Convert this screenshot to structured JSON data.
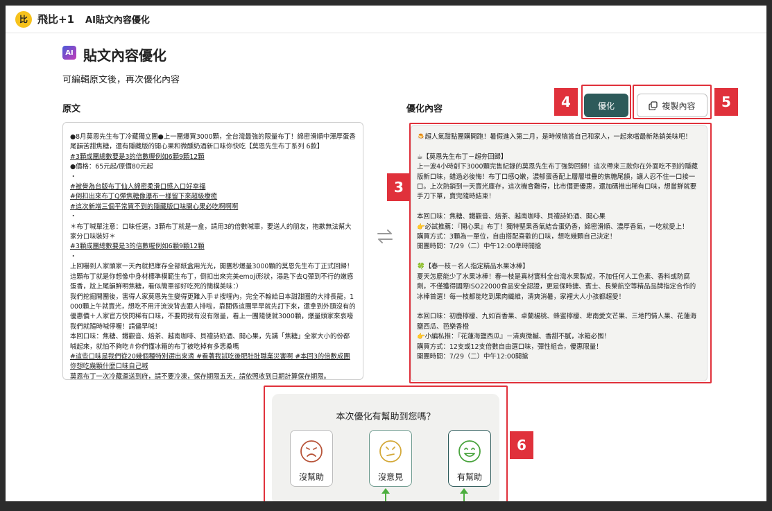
{
  "header": {
    "logo_text": "比",
    "brand": "飛比+1",
    "app_title": "AI貼文內容優化"
  },
  "page": {
    "ai_badge": "AI",
    "title": "貼文內容優化",
    "subtitle": "可編輯原文後，再次優化內容"
  },
  "labels": {
    "original": "原文",
    "optimized": "優化內容"
  },
  "original_lines": [
    {
      "t": "●8月莫恩先生布丁冷藏獨立團●上一團爆買3000顆，全台灣最強的限量布丁！綿密滑順中渾厚蛋香尾韻苦甜焦糖，還有隱藏版的開心果和微醺奶酒新口味你快吃【莫恩先生布丁系列 6款】",
      "u": false
    },
    {
      "t": "#3顆成團總數要是3的倍數喔例如6顆9顆12顆",
      "u": true
    },
    {
      "t": "●價格：65元起/原價80元起",
      "u": false
    },
    {
      "t": "・",
      "u": false
    },
    {
      "t": "#被譽為台版布丁仙人綿密柔滑口感入口好幸福",
      "u": true
    },
    {
      "t": "#倒扣出來布丁Q彈焦糖像瀑布一樣留下來超級療癒",
      "u": true
    },
    {
      "t": "#這次新增三個平常買不到的隱藏版口味開心果必吃啊啊啊",
      "u": true
    },
    {
      "t": "・",
      "u": false
    },
    {
      "t": "＊布丁喊單注意：口味任選，3顆布丁就是一盒，請用3的倍數喊單，要送人的朋友，抱歉無法幫大家分口味裝好＊",
      "u": false
    },
    {
      "t": "#3顆成團總數要是3的倍數喔例如6顆9顆12顆",
      "u": true
    },
    {
      "t": "・",
      "u": false
    },
    {
      "t": "上回嚇到人家頭家一天內就把庫存全部紙盒用光光，開團秒爆量3000顆的莫恩先生布丁正式回歸！這顆布丁就是你想像中身材標準模範生布丁，倒扣出來完美emoji形狀，湯匙下去Q彈到不行的嫩感蛋香，尬上尾韻鮮明焦糖，看似簡單卻好吃死的簡樸美味：）",
      "u": false
    },
    {
      "t": "我們挖掘開團後，害得人家莫恩先生變得更難入手＃搜哩內，完全不輸給日本甜甜圈的大排長龍，1000顆上午就賣光，想吃不用汗流浹背去跟人排啦，靠關係這團早早就先訂下來，還拿到外頭沒有的優惠價＋人家官方快閃稀有口味，不要問我有沒有限量，看上一團隨便就3000顆，爆量頭家來哀嚎我們就隨時喊停喔！請儘早喊！",
      "u": false
    },
    {
      "t": "本回口味：焦糖、鐵觀音、焙茶、越南咖啡、貝禮詩奶酒、開心果，先講「焦糖」全家大小的份都喊起來，就怕不夠吃＃你們懂冰箱的布丁被吃掉有多悲桑嗎 ",
      "u": false
    },
    {
      "t": "#這些口味是我們從20幾個種特別選出來滴 #看著我試吃後肥肚肚職業災害啊 #本回3的倍數成團你想吃幾顆什麼口味自己喊",
      "u": true
    },
    {
      "t": "莫恩布丁一次冷藏運送到府，請不要冷凍，保存期限五天，請依照收到日期計算保存期限。",
      "u": false
    }
  ],
  "optimized_lines": [
    "🍮超人氣甜點團購開跑！暑假進入第二月，是時候犒賞自己和家人，一起來嚐最新熱銷美味吧！",
    "",
    "☕【莫恩先生布丁－超夯回歸】",
    "上一波4小時創下3000顆完售紀錄的莫恩先生布丁強勢回歸！這次帶來三款你在外面吃不到的隱藏版新口味，錯過必後悔！布丁口感Q嫩，濃郁蛋香配上層層堆疊的焦糖尾韻，讓人忍不住一口接一口。上次熱銷到一天賣光庫存，這次機會難得，比市價更優惠，還加碼推出稀有口味，想嘗鮮就要手刀下單，賣完隨時結束！",
    "",
    "本回口味：焦糖、鐵觀音、焙茶、越南咖啡、貝禮詩奶酒、開心果",
    "👉必試推薦：『開心果』布丁！獨特堅果香氣結合蛋奶香，綿密滑順、濃厚香氣，一吃就愛上！",
    "購買方式：3顆為一單位，自由搭配喜歡的口味，想吃幾顆自己決定！",
    "開團時間：7/29（二）中午12:00準時開搶",
    "",
    "🍀【春一枝－名人指定精品水果冰棒】",
    "夏天怎麼能少了水果冰棒！春一枝是真材實料全台灣水果製成，不加任何人工色素、香料或防腐劑，不僅獲得國際ISO22000食品安全認證，更是保時捷、賓士、長榮航空等精品品牌指定合作的冰棒首選！每一枝都能吃到果肉纖維，清爽消暑，家裡大人小孩都超愛！",
    "",
    "本回口味：初鹿檸檬、九如百香果、卓蘭楊桃、蜂蜜檸檬、卑南愛文芒果、三地門情人果、花蓮海鹽西瓜、芭樂香橙",
    "👉小編私推：『花蓮海鹽西瓜』－清爽微鹹、香甜不膩，冰箱必囤！",
    "購買方式：12支或12支倍數自由選口味，彈性組合，優惠限量！",
    "開團時間：7/29（二）中午12:00開搶"
  ],
  "toolbar": {
    "optimize_label": "優化",
    "copy_label": "複製內容"
  },
  "feedback": {
    "question": "本次優化有幫助到您嗎？",
    "not_helpful": "沒幫助",
    "no_opinion": "沒意見",
    "helpful": "有幫助"
  },
  "callouts": {
    "c3": "3",
    "c4": "4",
    "c5": "5",
    "c6": "6"
  },
  "colors": {
    "accent": "#2d5a5a",
    "callout": "#e0313b",
    "arrow": "#4cae3e",
    "logo": "#f6c21c"
  }
}
